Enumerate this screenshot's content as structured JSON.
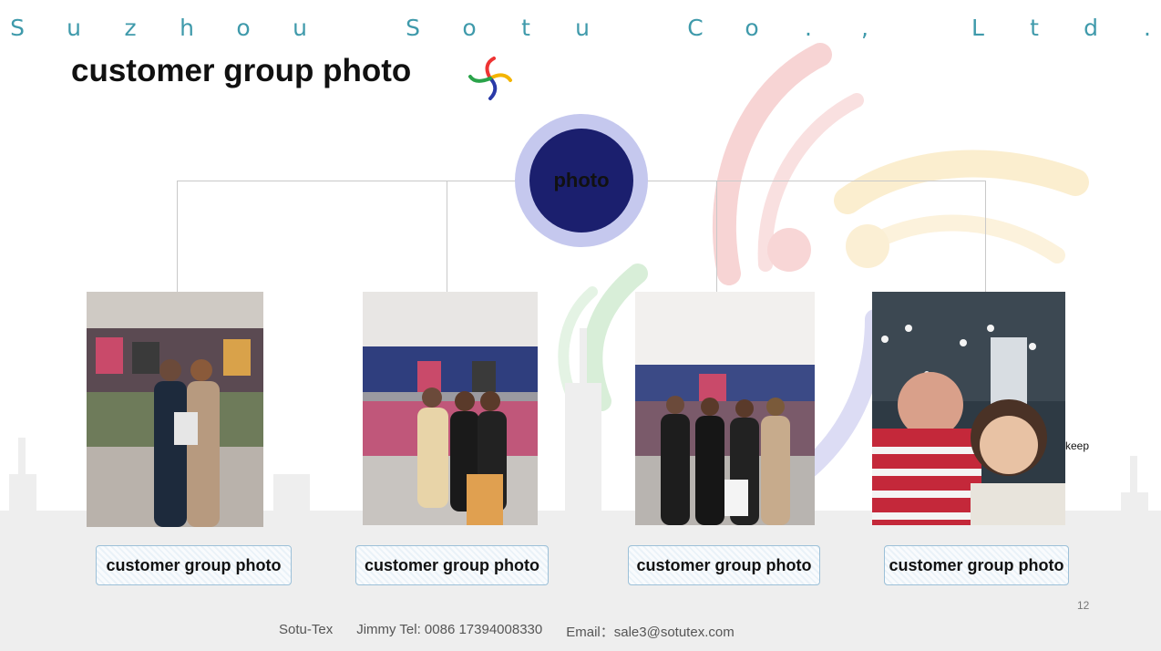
{
  "header": {
    "company_letters": [
      "S",
      "u",
      "z",
      "h",
      "o",
      "u",
      "",
      "S",
      "o",
      "t",
      "u",
      "",
      "C",
      "o",
      ".",
      ",",
      "",
      "L",
      "t",
      "d",
      "."
    ],
    "title": "customer group photo"
  },
  "hub": {
    "label": "photo"
  },
  "cards": [
    {
      "caption": "customer group photo",
      "photo_icon": "group-photo-1"
    },
    {
      "caption": "customer group photo",
      "photo_icon": "group-photo-2"
    },
    {
      "caption": "customer group photo",
      "photo_icon": "group-photo-3"
    },
    {
      "caption": "customer group photo",
      "photo_icon": "group-photo-4"
    }
  ],
  "side_text": "keep",
  "page_number": "12",
  "footer": {
    "brand": "Sotu-Tex",
    "contact": "Jimmy Tel: 0086 17394008330",
    "email": "Email：sale3@sotutex.com"
  },
  "colors": {
    "accent_teal": "#3f9aab",
    "hub_dark": "#1b1f6e",
    "hub_ring": "#c5c8ee"
  }
}
